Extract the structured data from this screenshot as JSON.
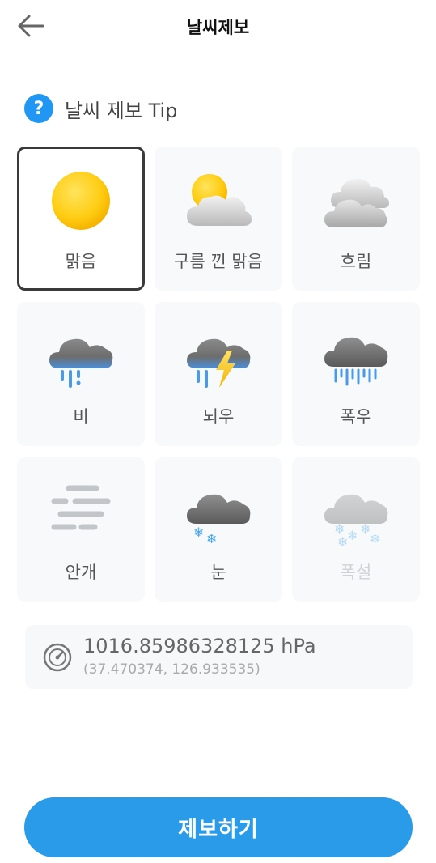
{
  "header": {
    "back_icon": "arrow-left-icon",
    "title": "날씨제보"
  },
  "tip": {
    "icon": "question-circle-icon",
    "mark": "?",
    "label": "날씨 제보 Tip"
  },
  "weather_options": [
    {
      "id": "clear",
      "label": "맑음",
      "icon": "sun-icon",
      "selected": true,
      "disabled": false
    },
    {
      "id": "partly-cloudy",
      "label": "구름 낀 맑음",
      "icon": "partly-cloudy-icon",
      "selected": false,
      "disabled": false
    },
    {
      "id": "cloudy",
      "label": "흐림",
      "icon": "cloudy-icon",
      "selected": false,
      "disabled": false
    },
    {
      "id": "rain",
      "label": "비",
      "icon": "rain-icon",
      "selected": false,
      "disabled": false
    },
    {
      "id": "thunderstorm",
      "label": "뇌우",
      "icon": "thunderstorm-icon",
      "selected": false,
      "disabled": false
    },
    {
      "id": "heavy-rain",
      "label": "폭우",
      "icon": "heavy-rain-icon",
      "selected": false,
      "disabled": false
    },
    {
      "id": "fog",
      "label": "안개",
      "icon": "fog-icon",
      "selected": false,
      "disabled": false
    },
    {
      "id": "snow",
      "label": "눈",
      "icon": "snow-icon",
      "selected": false,
      "disabled": false
    },
    {
      "id": "heavy-snow",
      "label": "폭설",
      "icon": "heavy-snow-icon",
      "selected": false,
      "disabled": true
    }
  ],
  "pressure": {
    "icon": "gauge-icon",
    "value": "1016.85986328125 hPa",
    "coords": "(37.470374, 126.933535)"
  },
  "submit": {
    "label": "제보하기"
  },
  "colors": {
    "accent": "#2a9be8",
    "tip_icon": "#2196f3",
    "selected_border": "#3a3a3a",
    "card_bg": "#f7f9fa"
  }
}
